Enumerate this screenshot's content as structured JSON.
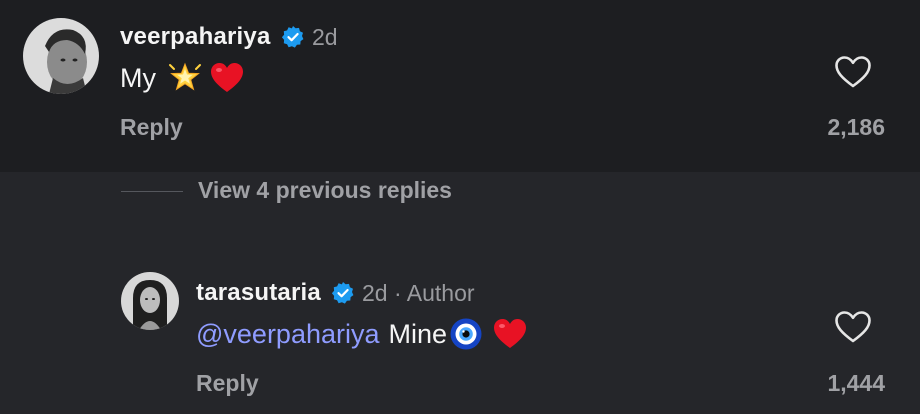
{
  "comment": {
    "username": "veerpahariya",
    "time": "2d",
    "text": "My",
    "emojis": [
      "glowing-star",
      "red-heart"
    ],
    "reply_label": "Reply",
    "likes": "2,186"
  },
  "view_replies_label": "View 4 previous replies",
  "reply": {
    "username": "tarasutaria",
    "meta": "2d · Author",
    "mention": "@veerpahariya",
    "text": "Mine",
    "emojis": [
      "nazar-amulet",
      "red-heart"
    ],
    "reply_label": "Reply",
    "likes": "1,444"
  },
  "colors": {
    "verified": "#1d9bf0",
    "mention": "#8f9cff",
    "background_top": "#1d1e21",
    "background_bottom": "#25262a"
  }
}
